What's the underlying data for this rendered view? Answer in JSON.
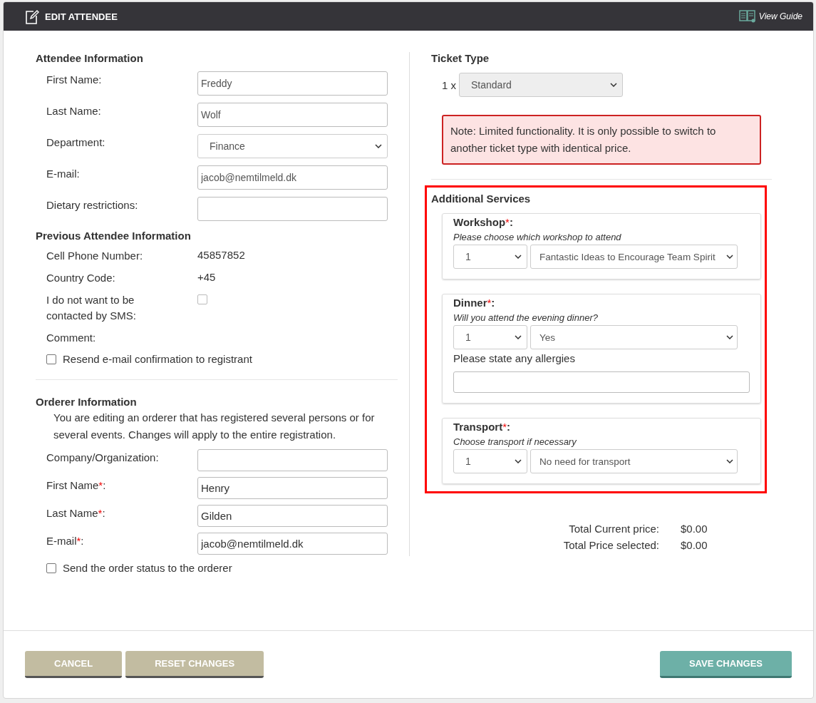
{
  "header": {
    "title": "EDIT ATTENDEE",
    "guide_link": "View Guide"
  },
  "attendee": {
    "heading": "Attendee Information",
    "fields": [
      {
        "kind": "input",
        "label": "First Name:",
        "value": "Freddy"
      },
      {
        "kind": "input",
        "label": "Last Name:",
        "value": "Wolf"
      },
      {
        "kind": "select",
        "label": "Department:",
        "value": "Finance"
      },
      {
        "kind": "input",
        "label": "E-mail:",
        "value": "jacob@nemtilmeld.dk"
      },
      {
        "kind": "input",
        "label": "Dietary restrictions:"
      }
    ]
  },
  "previous": {
    "heading": "Previous Attendee Information",
    "rows": [
      {
        "kind": "text",
        "label": "Cell Phone Number:",
        "value": "45857852"
      },
      {
        "kind": "text",
        "label": "Country Code:",
        "value": "+45"
      },
      {
        "kind": "checkbox",
        "label": "I do not want to be contacted by SMS:",
        "checked": false
      },
      {
        "kind": "text",
        "label": "Comment:"
      }
    ],
    "resend": {
      "label": "Resend e-mail confirmation to registrant",
      "checked": false
    }
  },
  "orderer": {
    "heading": "Orderer Information",
    "note": "You are editing an orderer that has registered several persons or for several events. Changes will apply to the entire registration.",
    "fields": [
      {
        "label": "Company/Organization:"
      },
      {
        "label": "First Name",
        "asterisk": "*",
        "colon": ":",
        "value": "Henry"
      },
      {
        "label": "Last Name",
        "asterisk": "*",
        "colon": ":",
        "value": "Gilden"
      },
      {
        "label": "E-mail",
        "asterisk": "*",
        "colon": ":",
        "value": "jacob@nemtilmeld.dk"
      }
    ],
    "send_status": {
      "label": "Send the order status to the orderer",
      "checked": false
    }
  },
  "ticket": {
    "heading": "Ticket Type",
    "quantity": "1 x",
    "type": "Standard",
    "note": "Note: Limited functionality. It is only possible to switch to another ticket type with identical price."
  },
  "services": {
    "heading": "Additional Services",
    "highlighted": true,
    "items": [
      {
        "title": "Workshop",
        "asterisk": "*",
        "colon": ":",
        "hint": "Please choose which workshop to attend",
        "quantity": "1",
        "option": "Fantastic Ideas to Encourage Team Spirit"
      },
      {
        "title": "Dinner",
        "asterisk": "*",
        "colon": ":",
        "hint": "Will you attend the evening dinner?",
        "quantity": "1",
        "option": "Yes",
        "extra_label": "Please state any allergies"
      },
      {
        "title": "Transport",
        "asterisk": "*",
        "colon": ":",
        "hint": "Choose transport if necessary",
        "quantity": "1",
        "option": "No need for transport"
      }
    ]
  },
  "totals": [
    {
      "label": "Total Current price:",
      "value": "$0.00"
    },
    {
      "label": "Total Price selected:",
      "value": "$0.00"
    }
  ],
  "buttons": [
    {
      "kind": "secondary",
      "label": "CANCEL"
    },
    {
      "kind": "secondary",
      "label": "RESET CHANGES"
    },
    {
      "kind": "primary",
      "label": "SAVE CHANGES"
    }
  ]
}
